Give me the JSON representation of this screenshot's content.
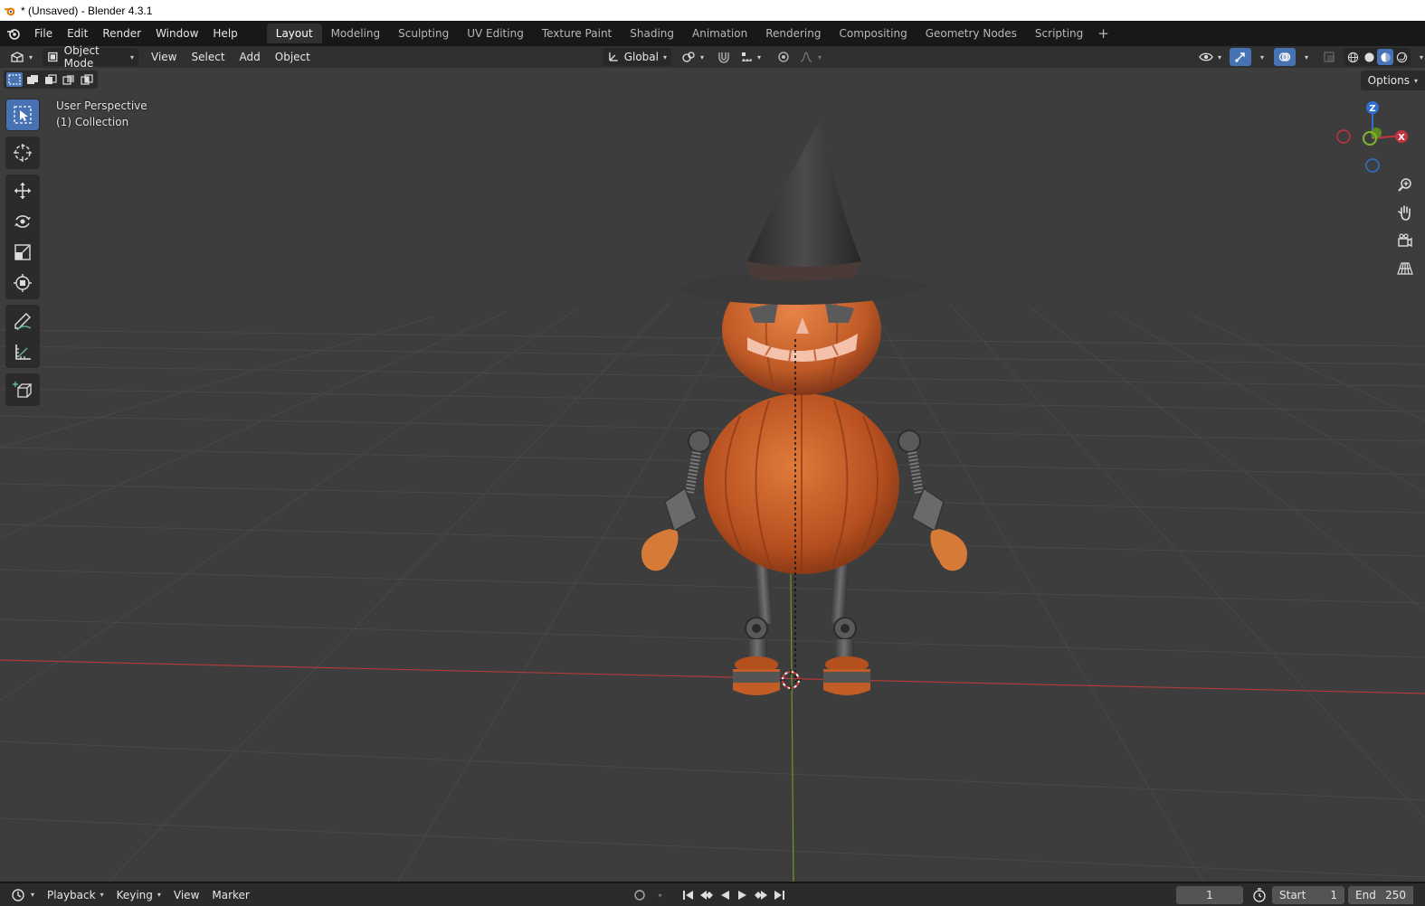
{
  "window": {
    "title": "* (Unsaved) - Blender 4.3.1"
  },
  "menus": [
    "File",
    "Edit",
    "Render",
    "Window",
    "Help"
  ],
  "workspaces": {
    "tabs": [
      "Layout",
      "Modeling",
      "Sculpting",
      "UV Editing",
      "Texture Paint",
      "Shading",
      "Animation",
      "Rendering",
      "Compositing",
      "Geometry Nodes",
      "Scripting"
    ],
    "active": "Layout",
    "add_label": "+"
  },
  "viewport_header": {
    "mode": "Object Mode",
    "menus": [
      "View",
      "Select",
      "Add",
      "Object"
    ],
    "orientation": "Global"
  },
  "viewport": {
    "perspective_label": "User Perspective",
    "collection_label": "(1) Collection",
    "options_label": "Options",
    "axis_labels": {
      "z": "Z",
      "x": "X"
    },
    "colors": {
      "background": "#3d3d3d",
      "x_axis": "#c4333f",
      "y_axis": "#80b82c",
      "z_axis": "#2f6fd0",
      "selected": "#4772b3"
    }
  },
  "timeline": {
    "menus": [
      "Playback",
      "Keying",
      "View",
      "Marker"
    ],
    "current_frame": "1",
    "start_label": "Start",
    "start_value": "1",
    "end_label": "End",
    "end_value": "250"
  }
}
